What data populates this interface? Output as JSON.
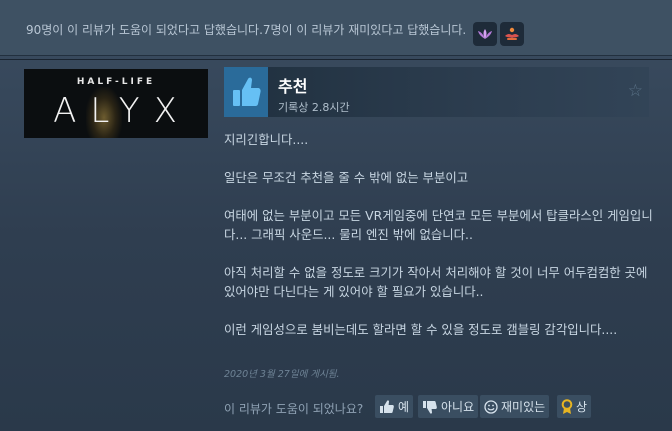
{
  "topbar": {
    "summary": "90명이 이 리뷰가 도움이 되었다고 답했습니다.7명이 이 리뷰가 재미있다고 답했습니다.",
    "awards": [
      {
        "icon": "lotus-award-icon",
        "color": "#b57bd9"
      },
      {
        "icon": "hands-award-icon",
        "color": "#e06c3c"
      }
    ]
  },
  "game": {
    "franchise": "HALF-LIFE",
    "title": "ALYX"
  },
  "review": {
    "recommendation": "추천",
    "playtime": "기록상 2.8시간",
    "paragraphs": [
      "지리긴합니다....",
      "일단은 무조건 추천을 줄 수 밖에 없는 부분이고",
      "여태에 없는 부분이고 모든 VR게임중에 단연코 모든 부분에서 탑클라스인 게임입니다... 그래픽 사운드... 물리 엔진 밖에 없습니다..",
      "아직 처리할 수 없을 정도로 크기가 작아서 처리해야 할 것이 너무 어두컴컴한 곳에 있어야만 다닌다는 게 있어야 할 필요가 있습니다..",
      "이런 게임성으로 붐비는데도 할라면 할 수 있을 정도로 갬블링 감각입니다...."
    ],
    "posted": "2020년 3월 27일에 게시됨."
  },
  "voting": {
    "question": "이 리뷰가 도움이 되었나요?",
    "yes_label": "예",
    "no_label": "아니요",
    "funny_label": "재미있는",
    "award_label": "상"
  },
  "colors": {
    "thumb_bg": "#2a6b9a",
    "thumb_fg": "#66c0f4",
    "award_gold": "#e6b422"
  }
}
